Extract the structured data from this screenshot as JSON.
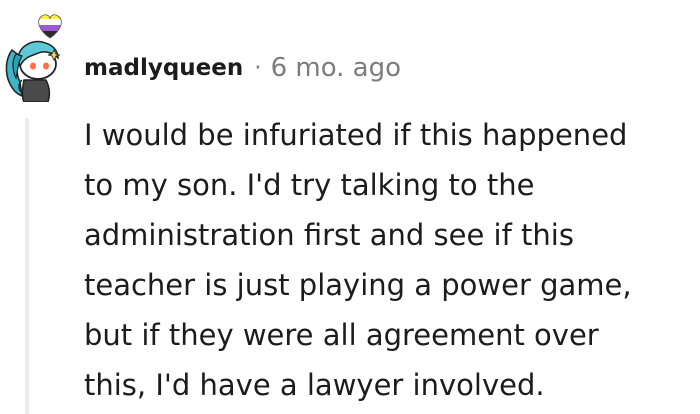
{
  "comment": {
    "author": {
      "username": "madlyqueen",
      "avatar_icon": "snoo-avatar-icon",
      "flair_icon": "nonbinary-heart-icon",
      "flair_colors": [
        "#fcf434",
        "#ffffff",
        "#9c59d1",
        "#2c2c2c"
      ]
    },
    "separator": "·",
    "timestamp": "6 mo. ago",
    "body_lines": [
      "I would be infuriated if this happened",
      "to my son. I'd try talking to the",
      "administration first and see if this",
      "teacher is just playing a power game,",
      "but if they were all agreement over",
      "this, I'd have a lawyer involved."
    ]
  }
}
